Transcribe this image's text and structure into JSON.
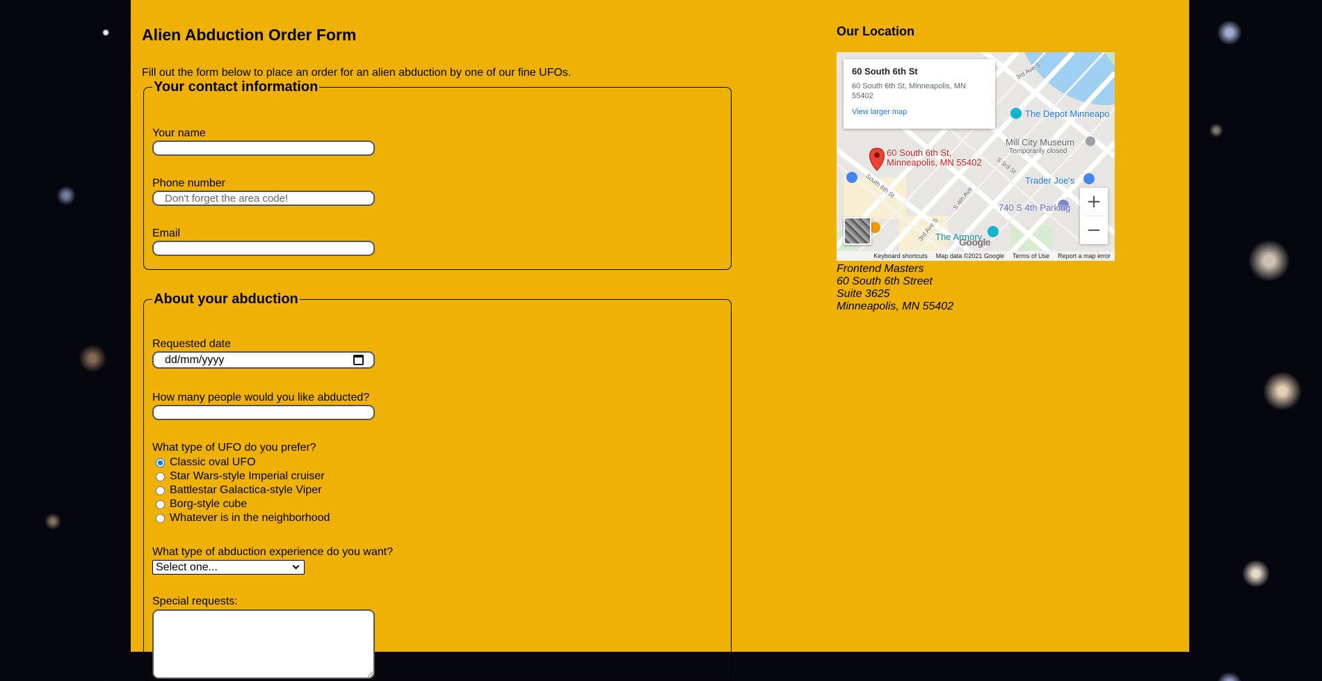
{
  "form": {
    "title": "Alien Abduction Order Form",
    "intro": "Fill out the form below to place an order for an alien abduction by one of our fine UFOs.",
    "contact": {
      "legend": "Your contact information",
      "name_label": "Your name",
      "phone_label": "Phone number",
      "phone_placeholder": "Don't forget the area code!",
      "email_label": "Email"
    },
    "abduction": {
      "legend": "About your abduction",
      "date_label": "Requested date",
      "date_placeholder": "dd/mm/yyyy",
      "people_label": "How many people would you like abducted?",
      "ufo_label": "What type of UFO do you prefer?",
      "ufo_options": [
        {
          "label": "Classic oval UFO",
          "checked": true
        },
        {
          "label": "Star Wars-style Imperial cruiser",
          "checked": false
        },
        {
          "label": "Battlestar Galactica-style Viper",
          "checked": false
        },
        {
          "label": "Borg-style cube",
          "checked": false
        },
        {
          "label": "Whatever is in the neighborhood",
          "checked": false
        }
      ],
      "experience_label": "What type of abduction experience do you want?",
      "experience_selected": "Select one...",
      "requests_label": "Special requests:"
    }
  },
  "location": {
    "heading": "Our Location",
    "map": {
      "card_title": "60 South 6th St",
      "card_address": "60 South 6th St, Minneapolis, MN 55402",
      "card_link": "View larger map",
      "pin_label_line1": "60 South 6th St,",
      "pin_label_line2": "Minneapolis, MN 55402",
      "poi_depot": "The Depot Minneapo",
      "poi_museum": "Mill City Museum",
      "poi_museum_status": "Temporarily closed",
      "poi_traders": "Trader Joe's",
      "poi_parking": "740 S 4th Parking",
      "poi_armory": "The Armory",
      "street_3rd_ave": "3rd Ave S",
      "street_s_3rd": "S 3rd St",
      "street_s_6th": "South 6th St",
      "street_s_4th_ave": "S 4th Ave",
      "street_3rd_ave_lower": "3rd Ave S",
      "google_logo": "Google",
      "footer_shortcuts": "Keyboard shortcuts",
      "footer_data": "Map data ©2021 Google",
      "footer_terms": "Terms of Use",
      "footer_report": "Report a map error"
    },
    "address_lines": [
      "Frontend Masters",
      "60 South 6th Street",
      "Suite 3625",
      "Minneapolis, MN 55402"
    ]
  },
  "colors": {
    "page_background": "#efb106",
    "radio_accent": "#0075ff",
    "map_pin": "#ea4335"
  }
}
